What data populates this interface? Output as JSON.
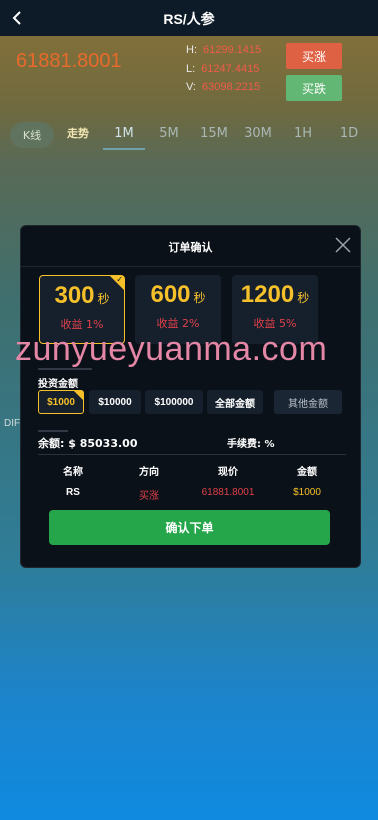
{
  "header": {
    "title": "RS/人参"
  },
  "quote": {
    "price": "61881.8001",
    "high_label": "H:",
    "high": "61299.1415",
    "low_label": "L:",
    "low": "61247.4415",
    "vol_label": "V:",
    "vol": "63098.2215",
    "buy_up": "买涨",
    "buy_down": "买跌"
  },
  "tabs": [
    "K线",
    "走势",
    "1M",
    "5M",
    "15M",
    "30M",
    "1H",
    "1D"
  ],
  "active_tab": "1M",
  "side_label": "DIF",
  "modal": {
    "title": "订单确认",
    "durations": [
      {
        "value": "300",
        "unit": "秒",
        "profit": "收益 1%",
        "selected": true
      },
      {
        "value": "600",
        "unit": "秒",
        "profit": "收益 2%",
        "selected": false
      },
      {
        "value": "1200",
        "unit": "秒",
        "profit": "收益 5%",
        "selected": false
      }
    ],
    "invest_label": "投资金额",
    "amounts": [
      "$1000",
      "$10000",
      "$100000",
      "全部金额"
    ],
    "selected_amount": "$1000",
    "other_amount": "其他金额",
    "balance": "余额: $ 85033.00",
    "fee": "手续费: %",
    "table": {
      "headers": [
        "名称",
        "方向",
        "现价",
        "金额"
      ],
      "row": [
        "RS",
        "买涨",
        "61881.8001",
        "$1000"
      ]
    },
    "confirm": "确认下单"
  },
  "watermark": "zunyueyuanma.com",
  "colors": {
    "accent": "#f5c02a",
    "up": "#e86a2b",
    "confirm": "#26a64a"
  }
}
